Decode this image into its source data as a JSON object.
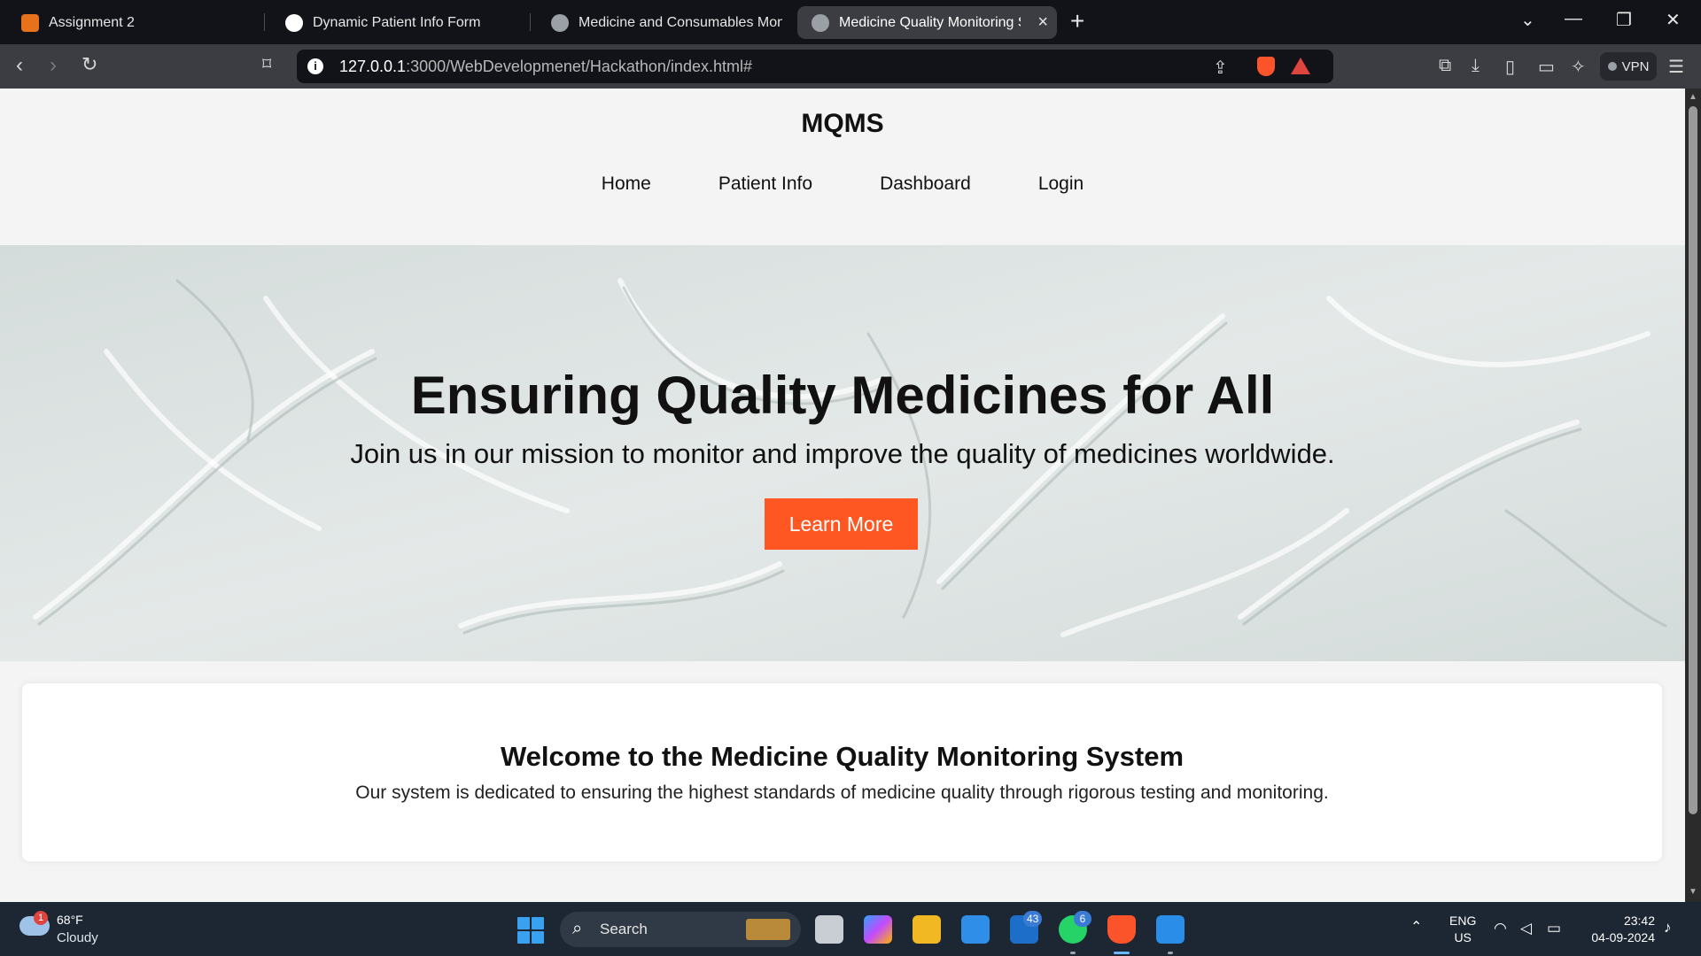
{
  "browser": {
    "tabs": [
      {
        "title": "Assignment 2",
        "active": false,
        "icon": "classroom-icon"
      },
      {
        "title": "Dynamic Patient Info Form",
        "active": false,
        "icon": "chatgpt-icon"
      },
      {
        "title": "Medicine and Consumables Monitoring",
        "active": false,
        "icon": "globe-icon"
      },
      {
        "title": "Medicine Quality Monitoring System",
        "active": true,
        "icon": "globe-icon"
      }
    ],
    "url_host": "127.0.0.1",
    "url_rest": ":3000/WebDevelopmenet/Hackathon/index.html#",
    "vpn_label": "VPN"
  },
  "site": {
    "brand": "MQMS",
    "nav": [
      "Home",
      "Patient Info",
      "Dashboard",
      "Login"
    ]
  },
  "hero": {
    "title": "Ensuring Quality Medicines for All",
    "subtitle": "Join us in our mission to monitor and improve the quality of medicines worldwide.",
    "button": "Learn More"
  },
  "welcome": {
    "title": "Welcome to the Medicine Quality Monitoring System",
    "text": "Our system is dedicated to ensuring the highest standards of medicine quality through rigorous testing and monitoring."
  },
  "taskbar": {
    "weather_badge": "1",
    "temperature": "68°F",
    "condition": "Cloudy",
    "search_label": "Search",
    "outlook_badge": "43",
    "whatsapp_badge": "6",
    "lang_line1": "ENG",
    "lang_line2": "US",
    "time": "23:42",
    "date": "04-09-2024"
  },
  "colors": {
    "accent_button": "#ff5722",
    "page_bg": "#f4f4f4",
    "browser_dark": "#111318"
  }
}
